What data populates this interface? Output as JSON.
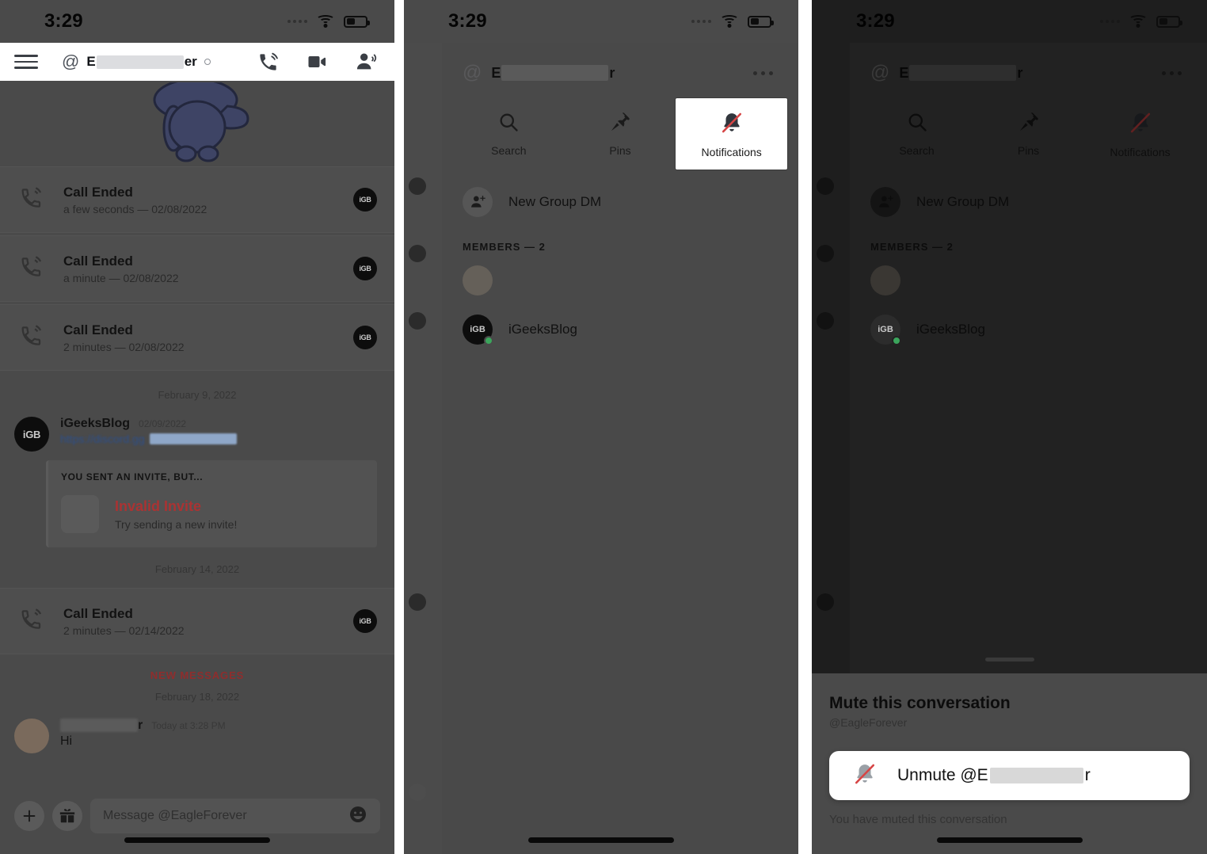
{
  "status_bar": {
    "time": "3:29"
  },
  "panel1": {
    "header": {
      "at": "@",
      "name_prefix": "E",
      "name_suffix": "er",
      "menu_icon": "hamburger-menu-icon",
      "call_icon": "voice-call-icon",
      "video_icon": "video-call-icon",
      "members_icon": "add-members-icon"
    },
    "calls": [
      {
        "title": "Call Ended",
        "meta": "a few seconds — 02/08/2022"
      },
      {
        "title": "Call Ended",
        "meta": "a minute — 02/08/2022"
      },
      {
        "title": "Call Ended",
        "meta": "2 minutes — 02/08/2022"
      }
    ],
    "date_divider_1": "February 9, 2022",
    "invite_message": {
      "author": "iGeeksBlog",
      "timestamp": "02/09/2022",
      "link_prefix": "https://discord.gg",
      "card_title": "YOU SENT AN INVITE, BUT...",
      "card_error": "Invalid Invite",
      "card_sub": "Try sending a new invite!"
    },
    "date_divider_2": "February 14, 2022",
    "call_last": {
      "title": "Call Ended",
      "meta": "2 minutes — 02/14/2022"
    },
    "new_messages_label": "NEW MESSAGES",
    "date_divider_3": "February 18, 2022",
    "last_message": {
      "author_suffix": "r",
      "timestamp": "Today at 3:28 PM",
      "text": "Hi"
    },
    "composer": {
      "placeholder": "Message @EagleForever",
      "plus_icon": "add-attachment-icon",
      "gift_icon": "gift-icon",
      "emoji_icon": "emoji-icon"
    },
    "avatar_label": "iGB"
  },
  "panel2": {
    "header": {
      "at": "@",
      "name_prefix": "E",
      "name_suffix": "r",
      "more_icon": "more-options-icon"
    },
    "tabs": [
      {
        "label": "Search",
        "icon": "search-icon",
        "active": false
      },
      {
        "label": "Pins",
        "icon": "pin-icon",
        "active": false
      },
      {
        "label": "Notifications",
        "icon": "bell-muted-icon",
        "active": true
      }
    ],
    "new_group_dm": "New Group DM",
    "members_header": "MEMBERS — 2",
    "members": [
      {
        "name": "",
        "redacted": true,
        "avatar_label": ""
      },
      {
        "name": "iGeeksBlog",
        "redacted": false,
        "avatar_label": "iGB",
        "online": true
      }
    ]
  },
  "panel3": {
    "sheet": {
      "title": "Mute this conversation",
      "subtitle": "@EagleForever",
      "button_prefix": "Unmute @E",
      "button_suffix": "r",
      "button_icon": "bell-muted-icon",
      "footer": "You have muted this conversation"
    }
  },
  "colors": {
    "accent_red": "#d64545",
    "online_green": "#3ba55c",
    "panel_bg": "#4a4a4a",
    "dim_panel_bg": "#1e1e1e"
  }
}
